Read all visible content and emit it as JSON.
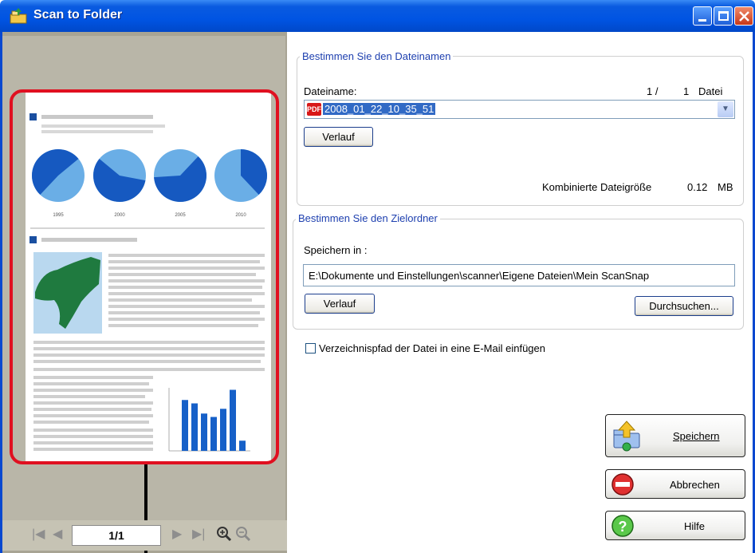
{
  "window": {
    "title": "Scan to Folder"
  },
  "preview": {
    "page_indicator": "1/1"
  },
  "filename_group": {
    "legend": "Bestimmen Sie den Dateinamen",
    "label": "Dateiname:",
    "file_index": "1 /",
    "file_total": "1",
    "file_unit": "Datei",
    "pdf_badge": "PDF",
    "value": "2008_01_22_10_35_51",
    "history_button": "Verlauf",
    "size_label": "Kombinierte Dateigröße",
    "size_value": "0.12",
    "size_unit": "MB"
  },
  "folder_group": {
    "legend": "Bestimmen Sie den Zielordner",
    "label": "Speichern in :",
    "path": "E:\\Dokumente und Einstellungen\\scanner\\Eigene Dateien\\Mein ScanSnap",
    "history_button": "Verlauf",
    "browse_button": "Durchsuchen..."
  },
  "email_checkbox": {
    "label": "Verzeichnispfad der Datei in eine E-Mail einfügen",
    "checked": false
  },
  "actions": {
    "save": "Speichern",
    "cancel": "Abbrechen",
    "help": "Hilfe"
  },
  "doc_thumbnail": {
    "pie_years": [
      "1995",
      "2000",
      "2005",
      "2010"
    ],
    "bar_values": [
      75,
      70,
      55,
      50,
      62,
      90,
      15
    ]
  },
  "colors": {
    "accent": "#1d3faf",
    "titlebar": "#0054e3",
    "highlight": "#e01020"
  }
}
